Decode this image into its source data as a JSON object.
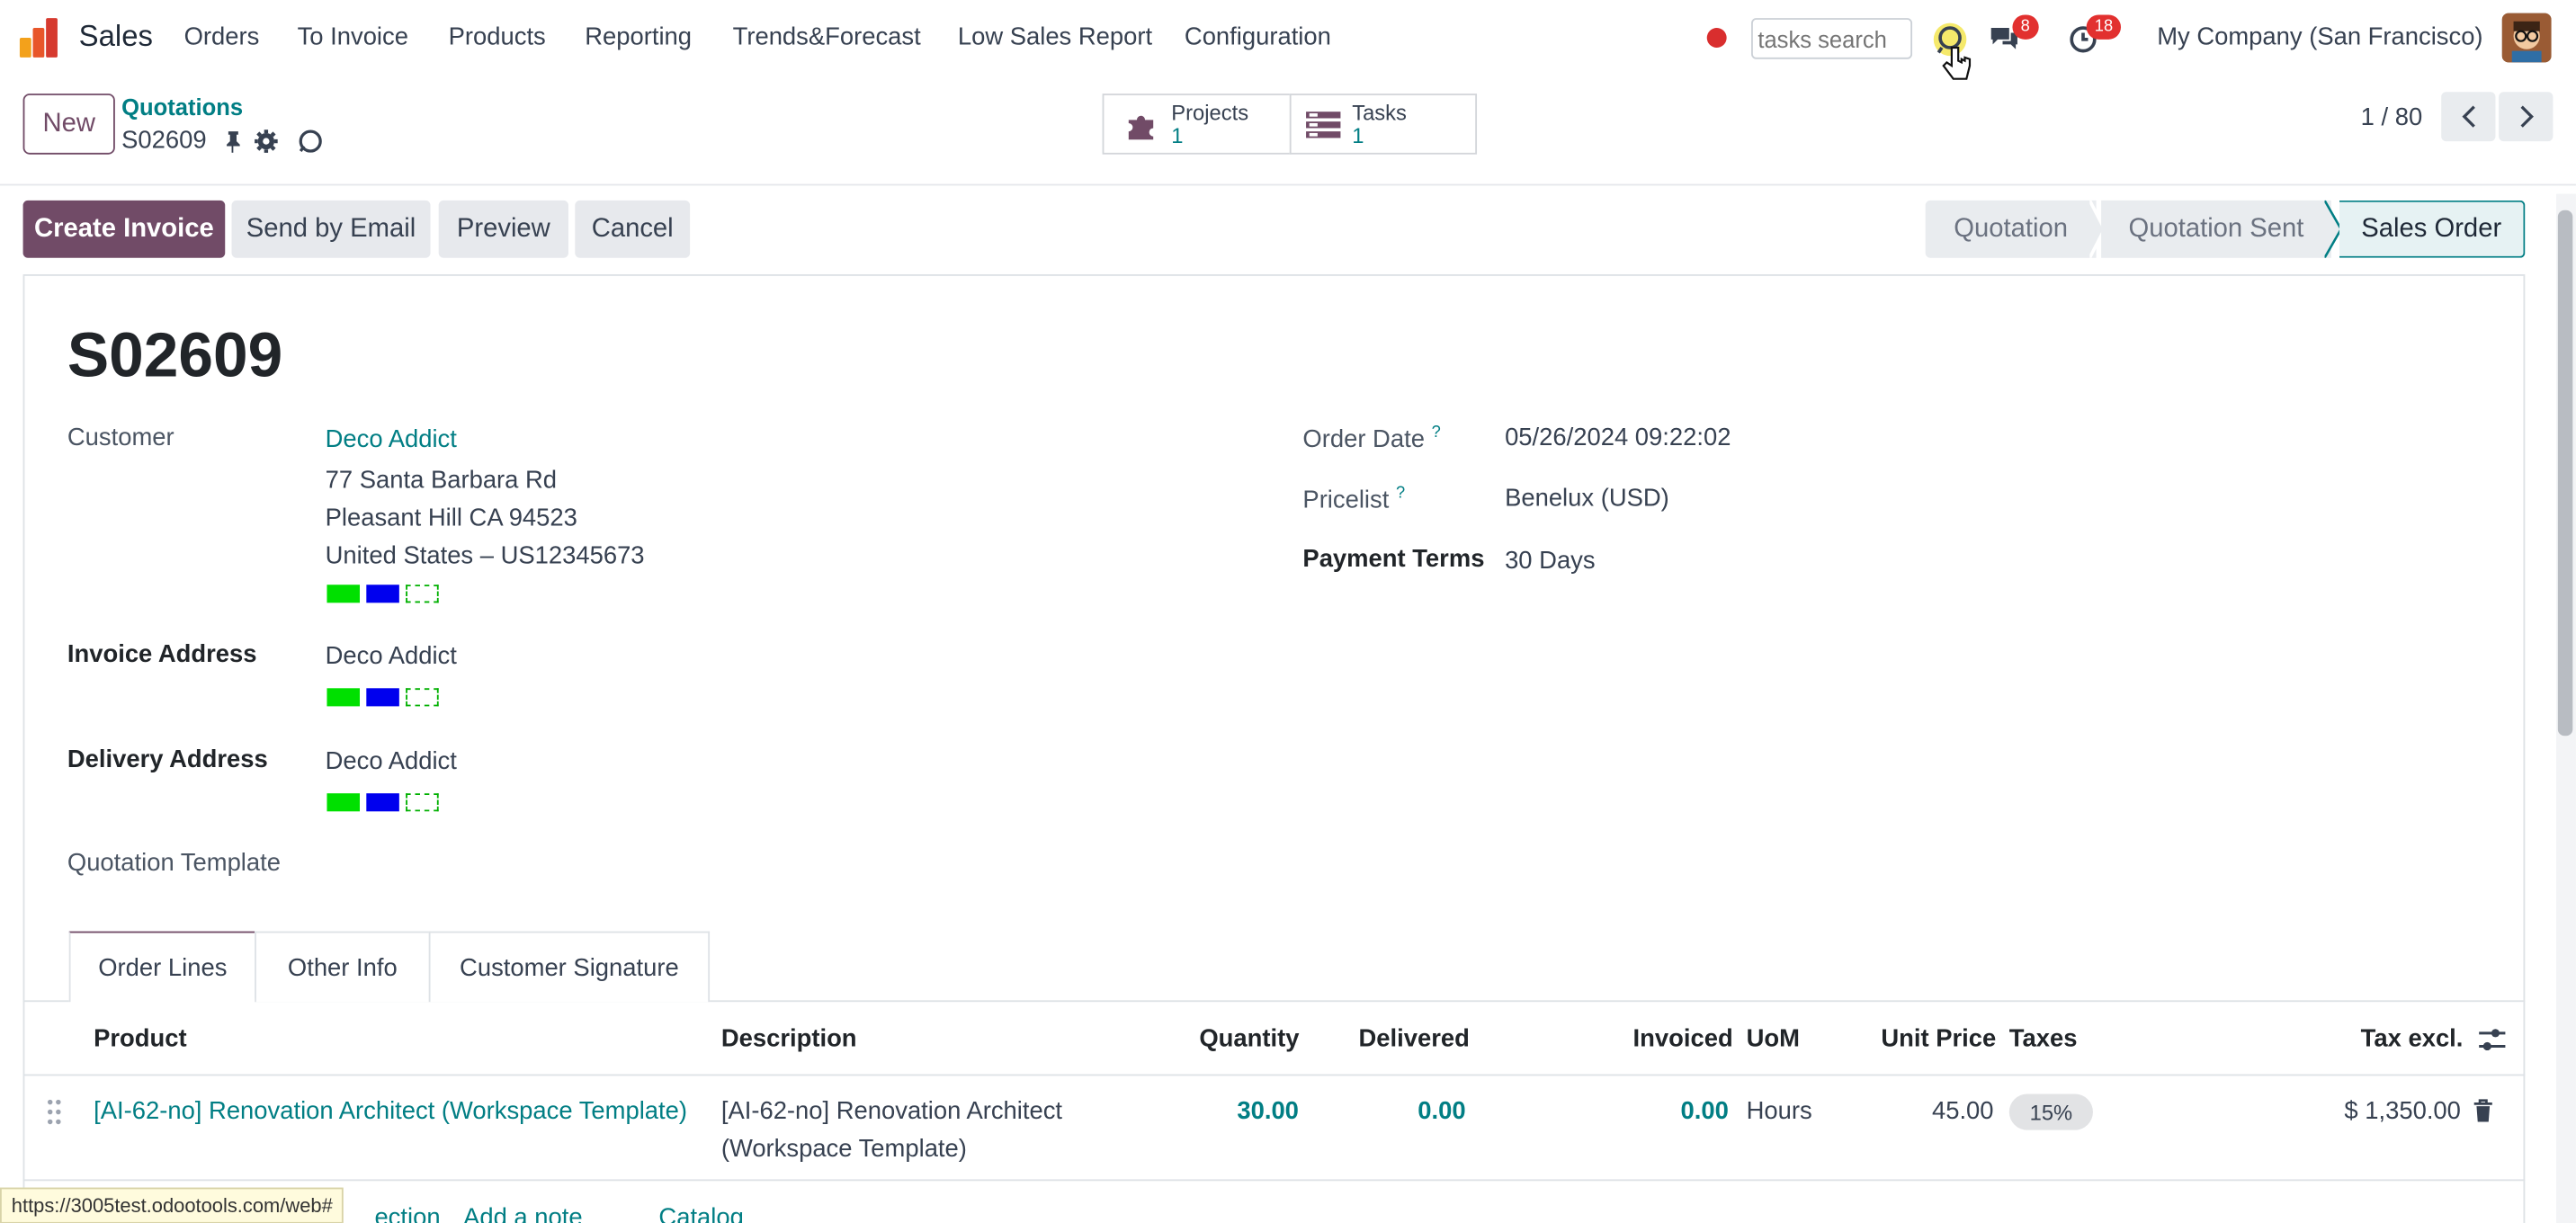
{
  "nav": {
    "app": "Sales",
    "menu": [
      "Orders",
      "To Invoice",
      "Products",
      "Reporting",
      "Trends&Forecast",
      "Low Sales Report",
      "Configuration"
    ],
    "search_placeholder": "tasks search",
    "messages_badge": "8",
    "activities_badge": "18",
    "company": "My Company (San Francisco)"
  },
  "control": {
    "new_label": "New",
    "breadcrumb": "Quotations",
    "record": "S02609",
    "projects_label": "Projects",
    "projects_count": "1",
    "tasks_label": "Tasks",
    "tasks_count": "1",
    "pager": "1 / 80"
  },
  "actions": {
    "create_invoice": "Create Invoice",
    "send_email": "Send by Email",
    "preview": "Preview",
    "cancel": "Cancel"
  },
  "stages": [
    "Quotation",
    "Quotation Sent",
    "Sales Order"
  ],
  "active_stage": "Sales Order",
  "form": {
    "title": "S02609",
    "customer_label": "Customer",
    "customer_name": "Deco Addict",
    "customer_addr1": "77 Santa Barbara Rd",
    "customer_addr2": "Pleasant Hill CA 94523",
    "customer_addr3": "United States – US12345673",
    "invoice_label": "Invoice Address",
    "invoice_value": "Deco Addict",
    "delivery_label": "Delivery Address",
    "delivery_value": "Deco Addict",
    "template_label": "Quotation Template",
    "order_date_label": "Order Date",
    "order_date": "05/26/2024 09:22:02",
    "pricelist_label": "Pricelist",
    "pricelist": "Benelux (USD)",
    "payment_label": "Payment Terms",
    "payment": "30 Days",
    "help_mark": "?"
  },
  "tabs": [
    "Order Lines",
    "Other Info",
    "Customer Signature"
  ],
  "table": {
    "headers": {
      "product": "Product",
      "description": "Description",
      "quantity": "Quantity",
      "delivered": "Delivered",
      "invoiced": "Invoiced",
      "uom": "UoM",
      "unit_price": "Unit Price",
      "taxes": "Taxes",
      "tax_excl": "Tax excl."
    },
    "rows": [
      {
        "product": "[AI-62-no] Renovation Architect (Workspace Template)",
        "description_1": "[AI-62-no] Renovation Architect",
        "description_2": "(Workspace Template)",
        "quantity": "30.00",
        "delivered": "0.00",
        "invoiced": "0.00",
        "uom": "Hours",
        "unit_price": "45.00",
        "tax": "15%",
        "subtotal": "$ 1,350.00"
      }
    ],
    "add_section": "ection",
    "add_note": "Add a note",
    "catalog": "Catalog"
  },
  "status_url": "https://3005test.odootools.com/web#",
  "colors": {
    "primary": "#714b67",
    "link": "#017e84",
    "swatch_green": "#00ff00",
    "swatch_blue": "#0000ff"
  }
}
